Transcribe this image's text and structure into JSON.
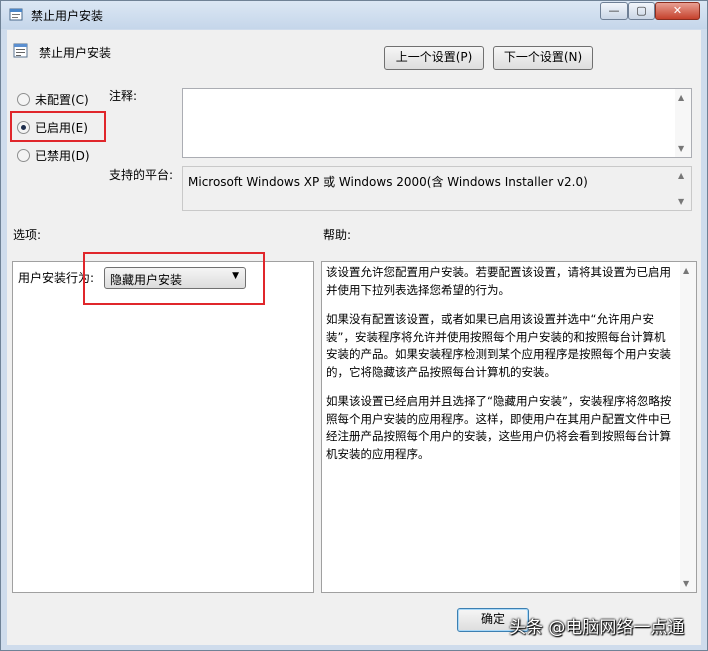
{
  "window": {
    "title": "禁止用户安装",
    "minimize": "—",
    "maximize": "▢",
    "close": "✕"
  },
  "policy": {
    "title": "禁止用户安装"
  },
  "nav": {
    "prev": "上一个设置(P)",
    "next": "下一个设置(N)"
  },
  "state_options": [
    {
      "label": "未配置(C)",
      "selected": false
    },
    {
      "label": "已启用(E)",
      "selected": true
    },
    {
      "label": "已禁用(D)",
      "selected": false
    }
  ],
  "comment": {
    "label": "注释:",
    "value": ""
  },
  "platform": {
    "label": "支持的平台:",
    "value": "Microsoft Windows XP 或 Windows 2000(含 Windows Installer v2.0)"
  },
  "options": {
    "heading": "选项:",
    "behavior_label": "用户安装行为:",
    "behavior_value": "隐藏用户安装"
  },
  "help": {
    "heading": "帮助:",
    "paragraphs": [
      "该设置允许您配置用户安装。若要配置该设置，请将其设置为已启用并使用下拉列表选择您希望的行为。",
      "如果没有配置该设置，或者如果已启用该设置并选中“允许用户安装”，安装程序将允许并使用按照每个用户安装的和按照每台计算机安装的产品。如果安装程序检测到某个应用程序是按照每个用户安装的，它将隐藏该产品按照每台计算机的安装。",
      "如果该设置已经启用并且选择了“隐藏用户安装”，安装程序将忽略按照每个用户安装的应用程序。这样，即使用户在其用户配置文件中已经注册产品按照每个用户的安装，这些用户仍将会看到按照每台计算机安装的应用程序。"
    ]
  },
  "footer": {
    "ok": "确定"
  },
  "watermark": "头条 @电脑网络一点通",
  "colors": {
    "highlight_red": "#e0262b",
    "title_bar": "#c5d6ea"
  }
}
